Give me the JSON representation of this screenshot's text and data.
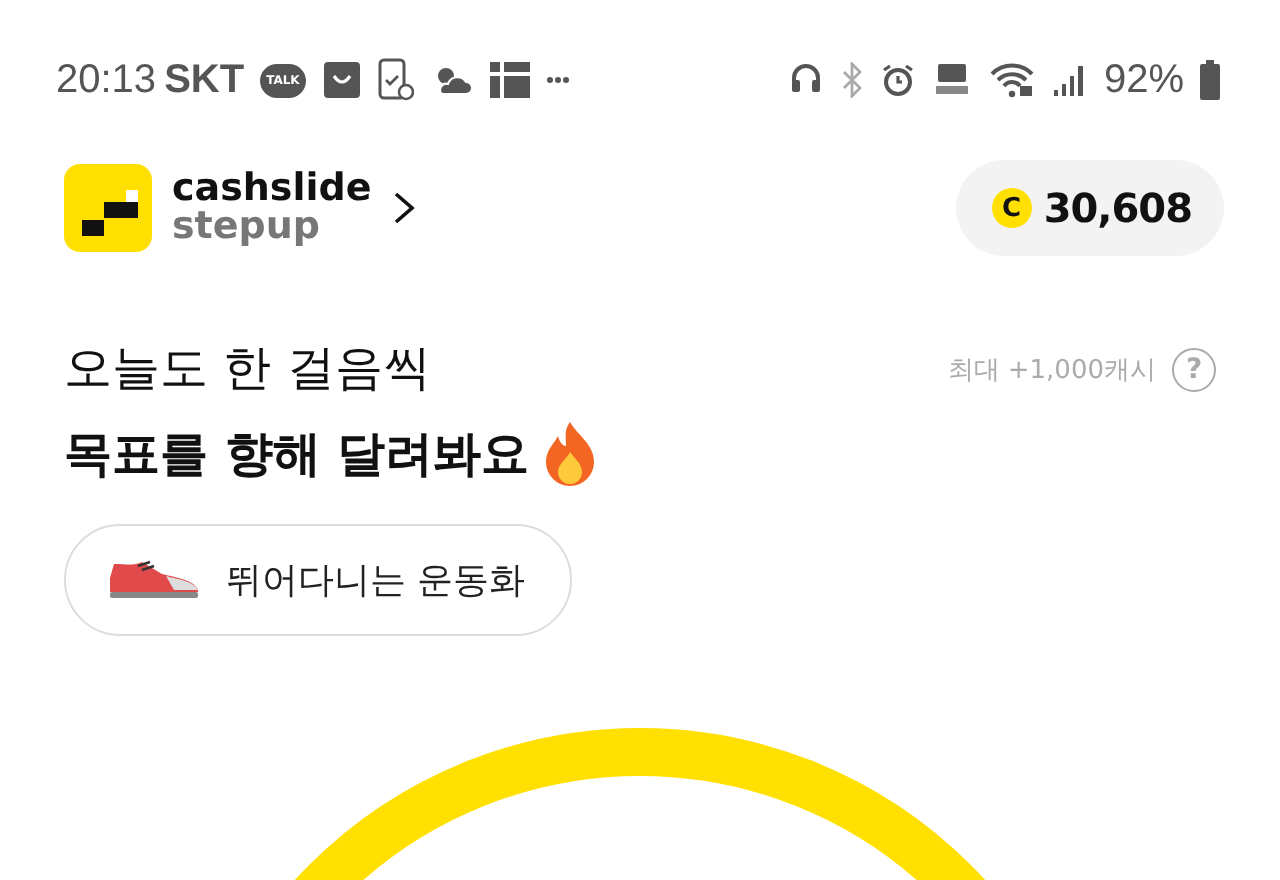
{
  "status_bar": {
    "time": "20:13",
    "carrier": "SKT",
    "talk_badge": "TALK",
    "battery": "92%"
  },
  "header": {
    "brand_line_1": "cashslide",
    "brand_line_2": "stepup",
    "balance": "30,608",
    "coin_symbol": "C"
  },
  "headline": {
    "line_1": "오늘도 한 걸음씩",
    "line_2": "목표를 향해 달려봐요",
    "reward_note": "최대 +1,000캐시",
    "help_symbol": "?"
  },
  "item_chip": {
    "label": "뛰어다니는 운동화"
  }
}
